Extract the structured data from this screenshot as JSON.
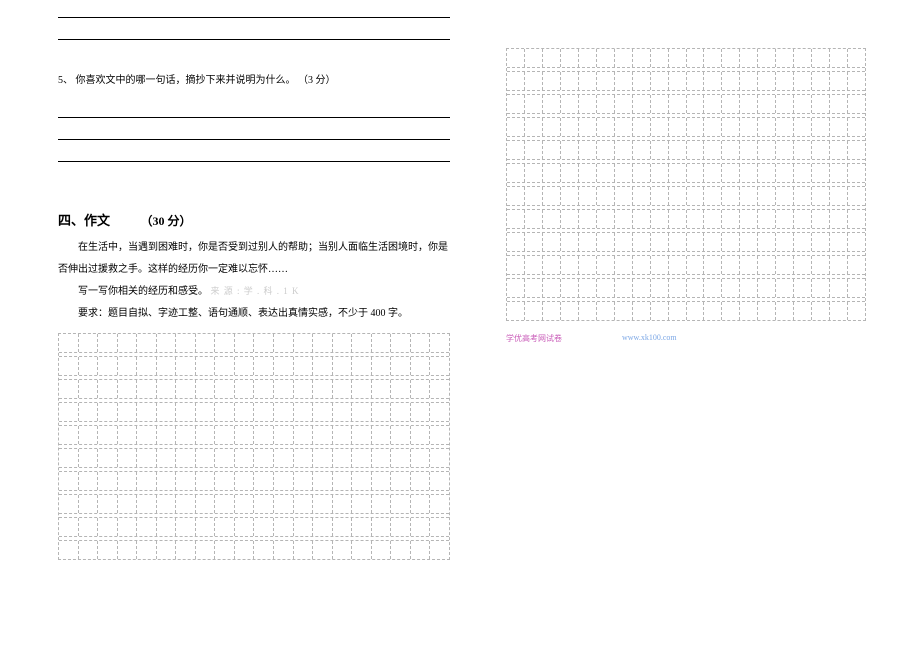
{
  "q5": {
    "number": "5、",
    "text": "你喜欢文中的哪一句话，摘抄下来并说明为什么。",
    "points": "（3 分）"
  },
  "section4": {
    "label": "四、作文",
    "points": "（30 分）"
  },
  "essay_prompt": {
    "p1": "在生活中，当遇到困难时，你是否受到过别人的帮助；当别人面临生活困境时，你是否伸出过援救之手。这样的经历你一定难以忘怀……",
    "p2_pre": "写一写你相关的经历和感受。",
    "p2_faded": "  来  源    :    学    .    科    .    1    K",
    "p3": "要求：题目自拟、字迹工整、语句通顺、表达出真情实感，不少于 400 字。"
  },
  "footer": {
    "src": "学优高考网试卷",
    "url": "www.xk100.com"
  },
  "grid": {
    "left_cols": 20,
    "left_rows": 10,
    "right_cols": 20,
    "right_rows": 12
  }
}
